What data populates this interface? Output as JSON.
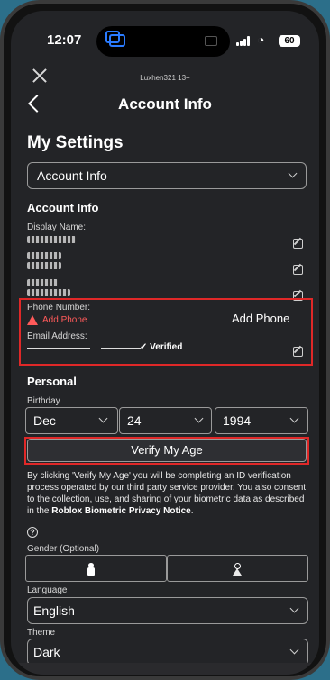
{
  "status_bar": {
    "time": "12:07",
    "battery": "60"
  },
  "top_bar": {
    "username": "Luxhen321 13+"
  },
  "header": {
    "title": "Account Info"
  },
  "settings": {
    "heading": "My Settings",
    "section_select": "Account Info"
  },
  "account_info": {
    "section_title": "Account Info",
    "display_name_label": "Display Name:",
    "phone_label": "Phone Number:",
    "add_phone_link": "Add Phone",
    "add_phone_button": "Add Phone",
    "email_label": "Email Address:",
    "email_status": "Verified"
  },
  "personal": {
    "section_title": "Personal",
    "birthday_label": "Birthday",
    "birth_month": "Dec",
    "birth_day": "24",
    "birth_year": "1994",
    "verify_button": "Verify My Age",
    "disclaimer_text": "By clicking 'Verify My Age' you will be completing an ID verification process operated by our third party service provider. You also consent to the collection, use, and sharing of your biometric data as described in the ",
    "disclaimer_link": "Roblox Biometric Privacy Notice",
    "disclaimer_end": ".",
    "help_glyph": "?",
    "gender_label": "Gender (Optional)",
    "language_label": "Language",
    "language_value": "English",
    "theme_label": "Theme",
    "theme_value": "Dark"
  },
  "colors": {
    "background": "#232427",
    "highlight_red": "#e02828",
    "warning_red": "#ff5a5a"
  },
  "icons": [
    "close-icon",
    "back-arrow-icon",
    "chevron-down-icon",
    "edit-icon",
    "warning-icon",
    "checkmark-icon",
    "help-icon",
    "male-icon",
    "female-icon"
  ]
}
